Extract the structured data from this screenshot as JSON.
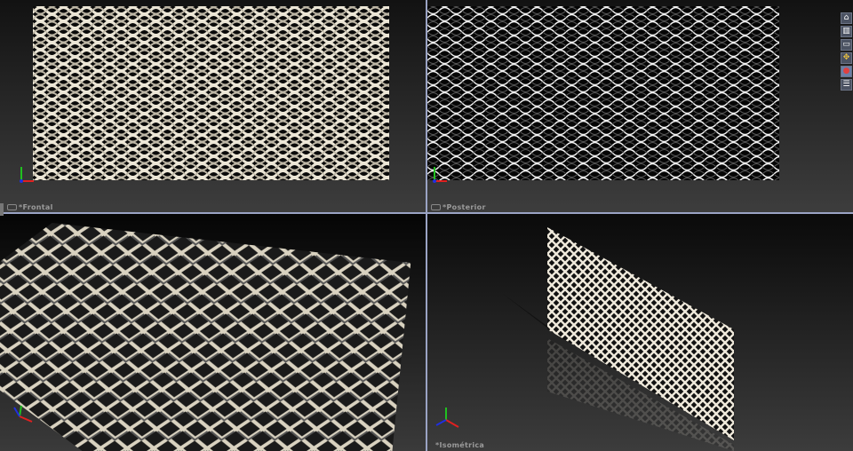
{
  "viewports": {
    "front": {
      "label": "*Frontal"
    },
    "back": {
      "label": "*Posterior"
    },
    "trimetric": {
      "label": ""
    },
    "isometric": {
      "label": "*Isométrica"
    }
  },
  "toolbar": {
    "items": [
      {
        "icon": "home-icon"
      },
      {
        "icon": "3d-part-icon"
      },
      {
        "icon": "folder-icon"
      },
      {
        "icon": "view-palette-icon"
      },
      {
        "icon": "appearance-icon"
      },
      {
        "icon": "custom-properties-icon"
      }
    ]
  },
  "colors": {
    "divider": "#9aa3c4",
    "mesh": "#e8e2d2",
    "axis_x": "#e02020",
    "axis_y": "#20c020",
    "axis_z": "#2030e0"
  }
}
